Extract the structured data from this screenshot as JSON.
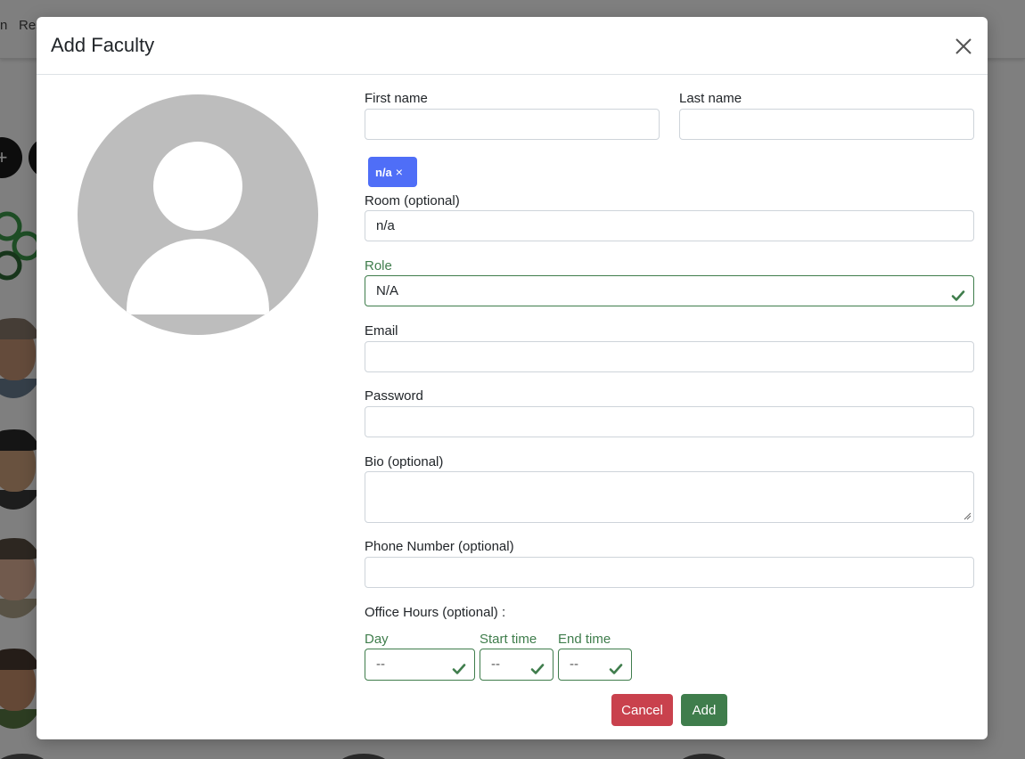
{
  "background": {
    "nav_fragment_1": "n",
    "nav_fragment_2": "Res",
    "add_button_icon": "+"
  },
  "modal": {
    "title": "Add Faculty",
    "close_icon": "close-icon"
  },
  "form": {
    "first_name": {
      "label": "First name",
      "value": ""
    },
    "last_name": {
      "label": "Last name",
      "value": ""
    },
    "room_tag": {
      "label": "n/a",
      "remove": "×"
    },
    "room": {
      "label": "Room (optional)",
      "value": "n/a"
    },
    "role": {
      "label": "Role",
      "value": "N/A"
    },
    "email": {
      "label": "Email",
      "value": ""
    },
    "password": {
      "label": "Password",
      "value": ""
    },
    "bio": {
      "label": "Bio (optional)",
      "value": ""
    },
    "phone": {
      "label": "Phone Number (optional)",
      "value": ""
    },
    "office_hours": {
      "label": "Office Hours (optional) :",
      "day": {
        "label": "Day",
        "value": "--"
      },
      "start": {
        "label": "Start time",
        "value": "--"
      },
      "end": {
        "label": "End time",
        "value": "--"
      }
    }
  },
  "buttons": {
    "cancel": "Cancel",
    "add": "Add"
  },
  "colors": {
    "valid_green": "#3f7d4c",
    "danger_red": "#c9414d",
    "tag_blue": "#4f6ef7",
    "avatar_gray": "#bdbdbd"
  }
}
